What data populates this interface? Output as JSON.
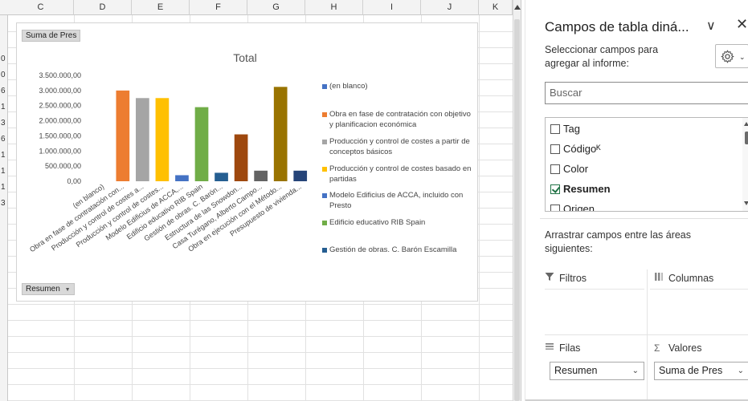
{
  "sheet": {
    "columns": [
      "C",
      "D",
      "E",
      "F",
      "G",
      "H",
      "I",
      "J",
      "K"
    ],
    "row_numbers": [
      "0",
      "0",
      "6",
      "1",
      "3",
      "6",
      "1",
      "1",
      "1",
      "3"
    ]
  },
  "pivot_chart": {
    "value_field_button": "Suma de Pres",
    "row_field_button": "Resumen",
    "row_field_arrow": "▼"
  },
  "chart_data": {
    "type": "bar",
    "title": "Total",
    "categories": [
      "(en blanco)",
      "Obra en fase de contratación con...",
      "Producción y control de costes a...",
      "Producción y control de costes...",
      "Modelo Edificius de ACCA,...",
      "Edificio educativo RIB Spain",
      "Gestión de obras. C. Barón...",
      "Estructura de las Snowdon...",
      "Casa Turégano, Alberto Campo...",
      "Obra en ejecución con el Método...",
      "Presupuesto de vivienda..."
    ],
    "values": [
      0,
      3000000,
      2750000,
      2750000,
      200000,
      2450000,
      280000,
      1550000,
      350000,
      3120000,
      350000
    ],
    "colors": [
      "#4472c4",
      "#ed7d31",
      "#a5a5a5",
      "#ffc000",
      "#4472c4",
      "#70ad47",
      "#255e91",
      "#9e480e",
      "#636363",
      "#997300",
      "#264478"
    ],
    "ylim": [
      0,
      3500000
    ],
    "y_ticks": [
      "3.500.000,00",
      "3.000.000,00",
      "2.500.000,00",
      "2.000.000,00",
      "1.500.000,00",
      "1.000.000,00",
      "500.000,00",
      "0,00"
    ],
    "legend_position": "right",
    "legend": [
      {
        "label": "(en blanco)",
        "color": "#4472c4"
      },
      {
        "label": "Obra en fase de contratación con objetivo y planificacion económica",
        "color": "#ed7d31"
      },
      {
        "label": "Producción y control de costes a partir de conceptos básicos",
        "color": "#a5a5a5"
      },
      {
        "label": "Producción y control de costes basado en partidas",
        "color": "#ffc000"
      },
      {
        "label": "Modelo Edificius de ACCA, incluido con Presto",
        "color": "#4472c4"
      },
      {
        "label": "Edificio educativo RIB Spain",
        "color": "#70ad47"
      },
      {
        "label": "Gestión de obras. C. Barón Escamilla",
        "color": "#255e91"
      }
    ]
  },
  "pane": {
    "title": "Campos de tabla diná...",
    "collapse_glyph": "∨",
    "close_glyph": "✕",
    "subtitle": "Seleccionar campos para agregar al informe:",
    "settings_arrow": "⌄",
    "search_placeholder": "Buscar",
    "fields": [
      {
        "label": "Tag",
        "checked": false
      },
      {
        "label": "Códigoᴷ",
        "checked": false
      },
      {
        "label": "Color",
        "checked": false
      },
      {
        "label": "Resumen",
        "checked": true
      },
      {
        "label": "Origen",
        "checked": false
      }
    ],
    "drag_label": "Arrastrar campos entre las áreas siguientes:",
    "areas": {
      "filters": "Filtros",
      "columns": "Columnas",
      "rows": "Filas",
      "values": "Valores",
      "rows_value": "Resumen",
      "values_value": "Suma de Pres"
    }
  }
}
